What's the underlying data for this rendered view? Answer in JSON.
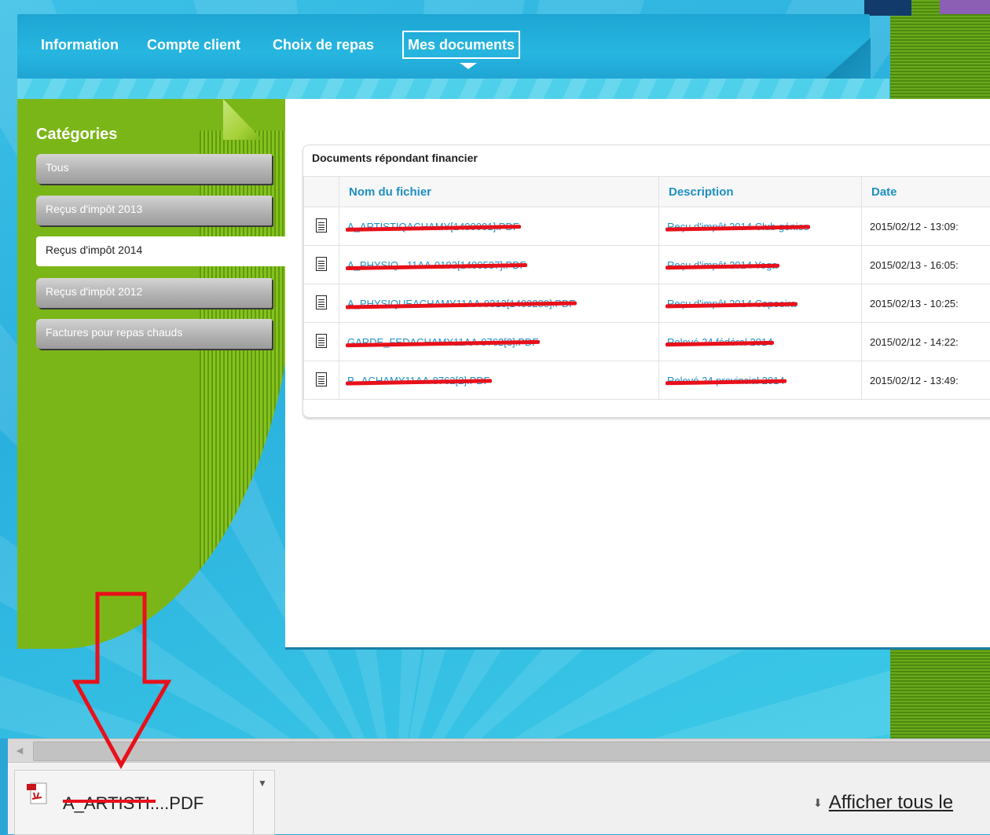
{
  "nav": {
    "items": [
      {
        "label": "Information"
      },
      {
        "label": "Compte client"
      },
      {
        "label": "Choix de repas"
      },
      {
        "label": "Mes documents"
      }
    ]
  },
  "sidebar": {
    "title": "Catégories",
    "items": [
      {
        "label": "Tous"
      },
      {
        "label": "Reçus d'impôt 2013"
      },
      {
        "label": "Reçus d'impôt 2014"
      },
      {
        "label": "Reçus d'impôt 2012"
      },
      {
        "label": "Factures pour repas chauds"
      }
    ]
  },
  "documents": {
    "title": "Documents répondant financier",
    "columns": [
      "Nom du fichier",
      "Description",
      "Date"
    ],
    "rows": [
      {
        "name": "A_ARTISTIQACHAMY[1400001].PDF",
        "description": "Reçu d'impôt 2014 Club génies",
        "date": "2015/02/12 - 13:09:"
      },
      {
        "name": "A_PHYSIQ...11AA-9193[1400537].PDF",
        "description": "Reçu d'impôt 2014 Yoga",
        "date": "2015/02/13 - 16:05:"
      },
      {
        "name": "A_PHYSIQUEACHAMY11AA-9313[1400280].PDF",
        "description": "Reçu d'impôt 2014 Capoeira",
        "date": "2015/02/13 - 10:25:"
      },
      {
        "name": "GARDE_FEDACHAMY11AA-8762[3].PDF",
        "description": "Relevé 24 fédéral 2014",
        "date": "2015/02/12 - 14:22:"
      },
      {
        "name": "P...ACHAMY11AA-8762[2].PDF",
        "description": "Relevé 24 provincial 2014",
        "date": "2015/02/12 - 13:49:"
      }
    ]
  },
  "download_bar": {
    "file_name": "A_ARTISTI....PDF",
    "show_all": "Afficher tous le"
  },
  "colors": {
    "accent": "#1e8fc3",
    "green": "#7bb618",
    "annotation": "#e8101a"
  }
}
